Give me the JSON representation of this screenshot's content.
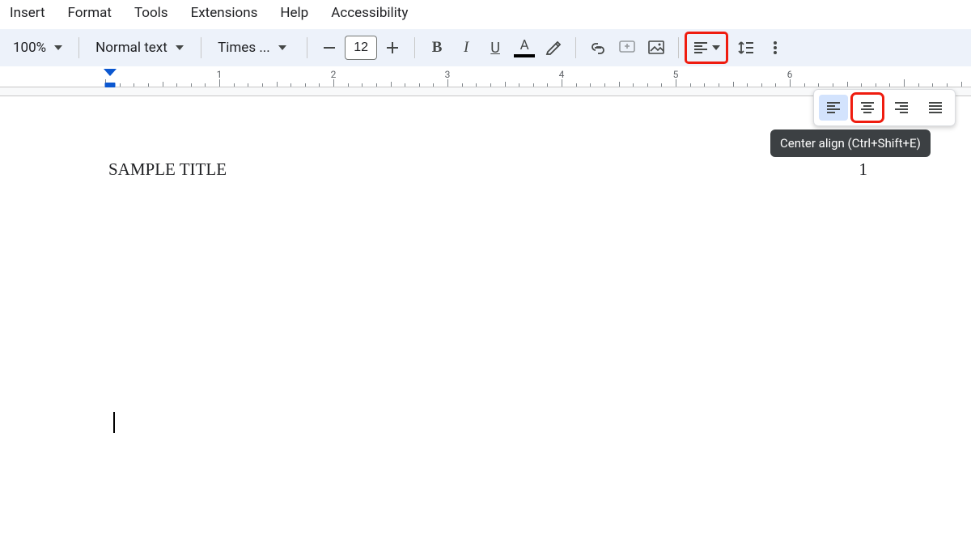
{
  "menu": {
    "items": [
      "Insert",
      "Format",
      "Tools",
      "Extensions",
      "Help",
      "Accessibility"
    ]
  },
  "toolbar": {
    "zoom": "100%",
    "style": "Normal text",
    "font": "Times ...",
    "fontsize": "12"
  },
  "ruler": {
    "numbers": [
      1,
      2,
      3,
      4,
      5,
      6
    ]
  },
  "tooltip": "Center align (Ctrl+Shift+E)",
  "document": {
    "header_left": "SAMPLE TITLE",
    "header_right": "1"
  }
}
